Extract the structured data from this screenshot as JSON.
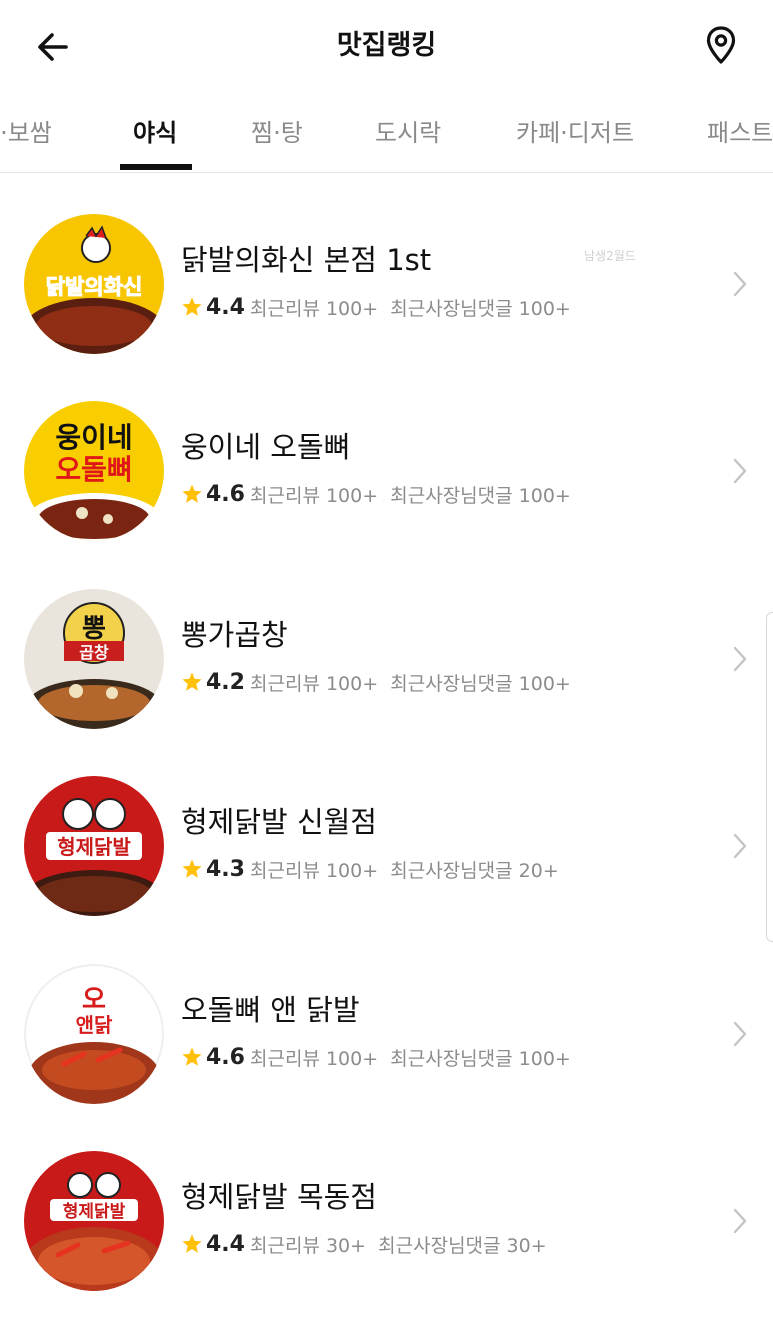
{
  "header": {
    "title": "맛집랭킹",
    "back_icon": "arrow-left-icon",
    "location_icon": "map-pin-icon"
  },
  "tabs": [
    {
      "label": "찜·보쌈"
    },
    {
      "label": "야식"
    },
    {
      "label": "찜·탕"
    },
    {
      "label": "도시락"
    },
    {
      "label": "카페·디저트"
    },
    {
      "label": "패스트푸드"
    }
  ],
  "active_tab": "야식",
  "watermark": "남생2월드",
  "colors": {
    "star": "#FFC107",
    "text": "#111111",
    "muted": "#8c8c8c",
    "underline": "#111111"
  },
  "restaurants": [
    {
      "name": "닭발의화신 본점 1st",
      "rating": "4.4",
      "reviews": "최근리뷰 100+",
      "owner_replies": "최근사장님댓글 100+",
      "logo_text": "닭발의화신"
    },
    {
      "name": "웅이네 오돌뼈",
      "rating": "4.6",
      "reviews": "최근리뷰 100+",
      "owner_replies": "최근사장님댓글 100+",
      "logo_line1": "웅이네",
      "logo_line2": "오돌뼈"
    },
    {
      "name": "뽕가곱창",
      "rating": "4.2",
      "reviews": "최근리뷰 100+",
      "owner_replies": "최근사장님댓글 100+",
      "logo_line1": "뽕",
      "logo_line2": "곱창"
    },
    {
      "name": "형제닭발 신월점",
      "rating": "4.3",
      "reviews": "최근리뷰 100+",
      "owner_replies": "최근사장님댓글 20+",
      "logo_text": "형제닭발"
    },
    {
      "name": "오돌뼈 앤 닭발",
      "rating": "4.6",
      "reviews": "최근리뷰 100+",
      "owner_replies": "최근사장님댓글 100+",
      "logo_line1": "오",
      "logo_line2": "앤닭"
    },
    {
      "name": "형제닭발 목동점",
      "rating": "4.4",
      "reviews": "최근리뷰 30+",
      "owner_replies": "최근사장님댓글 30+",
      "logo_text": "형제닭발"
    }
  ]
}
